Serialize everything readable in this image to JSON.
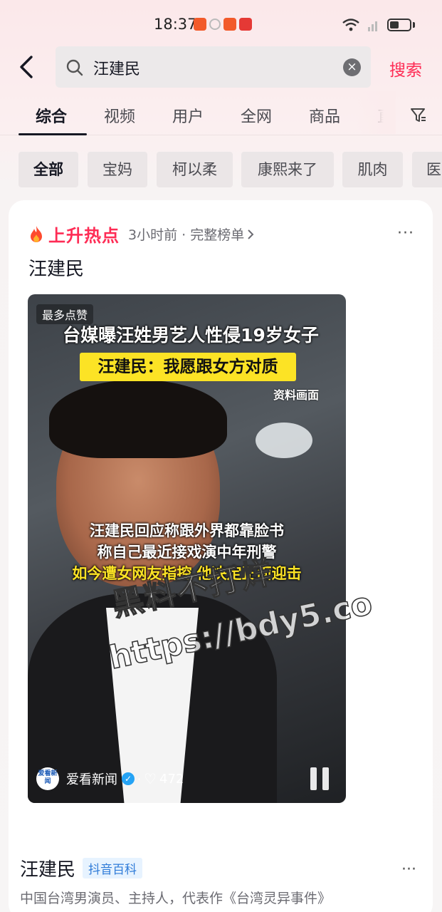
{
  "status_bar": {
    "time": "18:37"
  },
  "search": {
    "query": "汪建民",
    "clear_icon": "×",
    "submit_label": "搜索"
  },
  "tabs": [
    "综合",
    "视频",
    "用户",
    "全网",
    "商品",
    "直"
  ],
  "chips": [
    "全部",
    "宝妈",
    "柯以柔",
    "康熙来了",
    "肌肉",
    "医"
  ],
  "card": {
    "hot_label": "上升热点",
    "hot_meta": "3小时前 · 完整榜单",
    "more": "···",
    "title": "汪建民",
    "video": {
      "badge": "最多点赞",
      "headline": "台媒曝汪姓男艺人性侵19岁女子",
      "yellow_caption": "汪建民：我愿跟女方对质",
      "source_note": "资料画面",
      "subtitle_lines": [
        "汪建民回应称跟外界都靠脸书",
        "称自己最近接戏演中年刑警",
        "如今遭女网友指控 他决定正面迎击"
      ],
      "author": "爱看新闻",
      "avatar_text": "爱看新闻",
      "likes": "472"
    },
    "watermark": {
      "line1": "黑料不打烊",
      "line2": "https://bdy5.co"
    }
  },
  "encyclopedia": {
    "title": "汪建民",
    "tag": "抖音百科",
    "more": "···",
    "desc": "中国台湾男演员、主持人，代表作《台湾灵异事件》"
  },
  "colors": {
    "accent": "#fe2c55",
    "caption_yellow": "#fce325",
    "tag_blue": "#2f7bd8"
  }
}
